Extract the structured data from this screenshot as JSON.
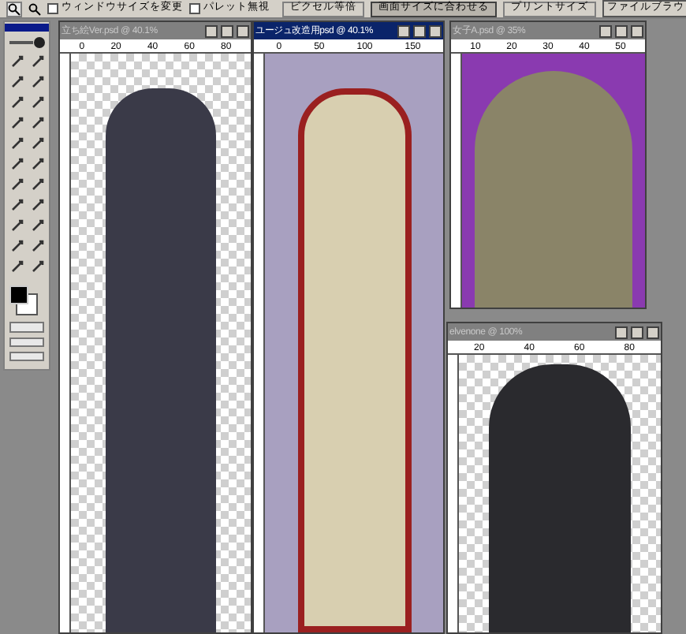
{
  "options_bar": {
    "checkboxes": [
      {
        "label": "ウィンドウサイズを変更",
        "checked": false
      },
      {
        "label": "パレット無視",
        "checked": false
      }
    ],
    "buttons": [
      {
        "label": "ピクセル等倍",
        "selected": false
      },
      {
        "label": "画面サイズに合わせる",
        "selected": true
      },
      {
        "label": "プリントサイズ",
        "selected": false
      }
    ],
    "palette_tab": "ファイルブラウ"
  },
  "windows": [
    {
      "title": "立ち絵Ver.psd @ 40.1%",
      "active": false,
      "ruler": [
        "0",
        "20",
        "40",
        "60",
        "80"
      ],
      "kind": "suit"
    },
    {
      "title": "ユージュ改造用psd @ 40.1%",
      "active": true,
      "ruler": [
        "0",
        "50",
        "100",
        "150"
      ],
      "kind": "robe"
    },
    {
      "title": "女子A.psd @ 35%",
      "active": false,
      "ruler": [
        "10",
        "20",
        "30",
        "40",
        "50"
      ],
      "kind": "girl"
    },
    {
      "title": "elvenone @ 100%",
      "active": false,
      "ruler": [
        "20",
        "40",
        "60",
        "80"
      ],
      "kind": "elf"
    }
  ]
}
